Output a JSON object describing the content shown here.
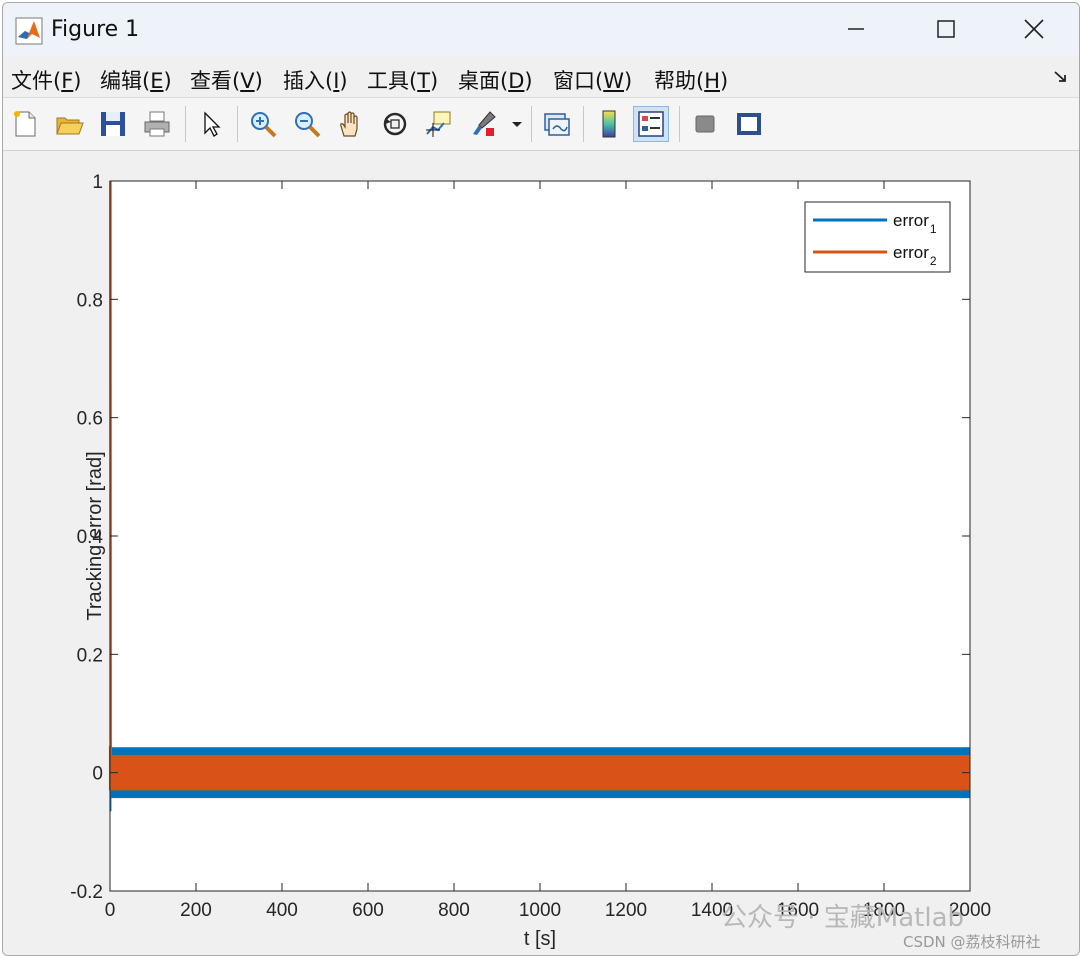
{
  "window": {
    "title": "Figure 1",
    "controls": [
      "minimize",
      "maximize",
      "close"
    ]
  },
  "menubar": {
    "items": [
      {
        "label": "文件(",
        "key": "F",
        "tail": ")"
      },
      {
        "label": "编辑(",
        "key": "E",
        "tail": ")"
      },
      {
        "label": "查看(",
        "key": "V",
        "tail": ")"
      },
      {
        "label": "插入(",
        "key": "I",
        "tail": ")"
      },
      {
        "label": "工具(",
        "key": "T",
        "tail": ")"
      },
      {
        "label": "桌面(",
        "key": "D",
        "tail": ")"
      },
      {
        "label": "窗口(",
        "key": "W",
        "tail": ")"
      },
      {
        "label": "帮助(",
        "key": "H",
        "tail": ")"
      }
    ]
  },
  "toolbar": {
    "buttons": [
      "new-figure-icon",
      "open-file-icon",
      "save-icon",
      "print-icon",
      "edit-plot-icon",
      "zoom-in-icon",
      "zoom-out-icon",
      "pan-icon",
      "rotate-3d-icon",
      "data-cursor-icon",
      "brush-icon",
      "brush-dropdown-icon",
      "link-plot-icon",
      "insert-colorbar-icon",
      "insert-legend-icon",
      "hide-plot-tools-icon",
      "show-plot-tools-icon"
    ],
    "active": "insert-legend-icon"
  },
  "watermark": {
    "text": "公众号 · 宝藏Matlab",
    "csdn": "CSDN @荔枝科研社"
  },
  "chart_data": {
    "type": "line",
    "xlabel": "t [s]",
    "ylabel": "Tracking error [rad]",
    "xlim": [
      0,
      2000
    ],
    "ylim": [
      -0.2,
      1
    ],
    "xticks": [
      0,
      200,
      400,
      600,
      800,
      1000,
      1200,
      1400,
      1600,
      1800,
      2000
    ],
    "yticks": [
      -0.2,
      0,
      0.2,
      0.4,
      0.6,
      0.8,
      1
    ],
    "yticklabels": [
      "-0.2",
      "0",
      "0.2",
      "0.4",
      "0.6",
      "0.8",
      "1"
    ],
    "grid": false,
    "legend_position": "top-right",
    "series": [
      {
        "name": "error",
        "subscript": "1",
        "color": "#0072BD",
        "envelope": {
          "initial_min": -0.065,
          "upper": 0.043,
          "lower": -0.043,
          "from_x": 2,
          "to_x": 2000
        }
      },
      {
        "name": "error",
        "subscript": "2",
        "color": "#D95319",
        "initial_peak": 1.0,
        "envelope": {
          "upper": 0.03,
          "lower": -0.03,
          "from_x": 2,
          "to_x": 2000
        }
      }
    ]
  }
}
